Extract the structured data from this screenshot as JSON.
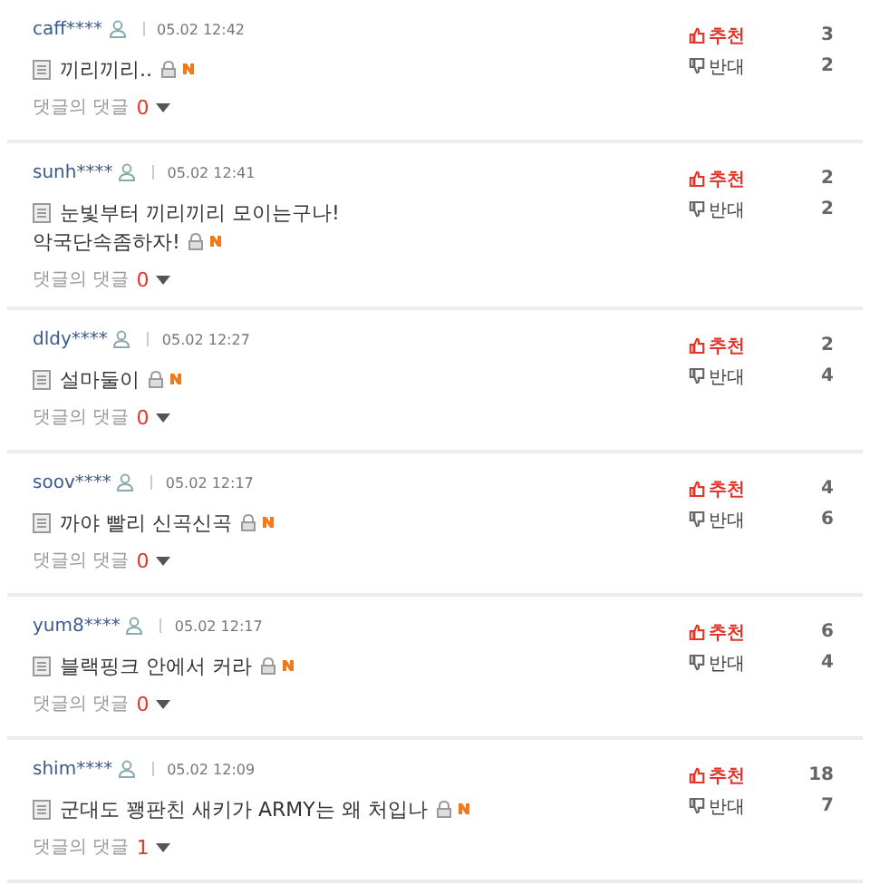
{
  "comments": [
    {
      "user": "caff****",
      "time": "05.02 12:42",
      "lines": [
        "끼리끼리.."
      ],
      "up_label": "추천",
      "up_count": "3",
      "down_label": "반대",
      "down_count": "2",
      "reply_label": "댓글의 댓글",
      "reply_count": "0"
    },
    {
      "user": "sunh****",
      "time": "05.02 12:41",
      "lines": [
        "눈빛부터 끼리끼리 모이는구나!",
        "악국단속좀하자!"
      ],
      "up_label": "추천",
      "up_count": "2",
      "down_label": "반대",
      "down_count": "2",
      "reply_label": "댓글의 댓글",
      "reply_count": "0"
    },
    {
      "user": "dldy****",
      "time": "05.02 12:27",
      "lines": [
        "설마둘이"
      ],
      "up_label": "추천",
      "up_count": "2",
      "down_label": "반대",
      "down_count": "4",
      "reply_label": "댓글의 댓글",
      "reply_count": "0"
    },
    {
      "user": "soov****",
      "time": "05.02 12:17",
      "lines": [
        "까야 빨리 신곡신곡"
      ],
      "up_label": "추천",
      "up_count": "4",
      "down_label": "반대",
      "down_count": "6",
      "reply_label": "댓글의 댓글",
      "reply_count": "0"
    },
    {
      "user": "yum8****",
      "time": "05.02 12:17",
      "lines": [
        "블랙핑크 안에서 커라"
      ],
      "up_label": "추천",
      "up_count": "6",
      "down_label": "반대",
      "down_count": "4",
      "reply_label": "댓글의 댓글",
      "reply_count": "0"
    },
    {
      "user": "shim****",
      "time": "05.02 12:09",
      "lines": [
        "군대도 꽹판친 새키가 ARMY는 왜 처입나"
      ],
      "up_label": "추천",
      "up_count": "18",
      "down_label": "반대",
      "down_count": "7",
      "reply_label": "댓글의 댓글",
      "reply_count": "1"
    }
  ]
}
